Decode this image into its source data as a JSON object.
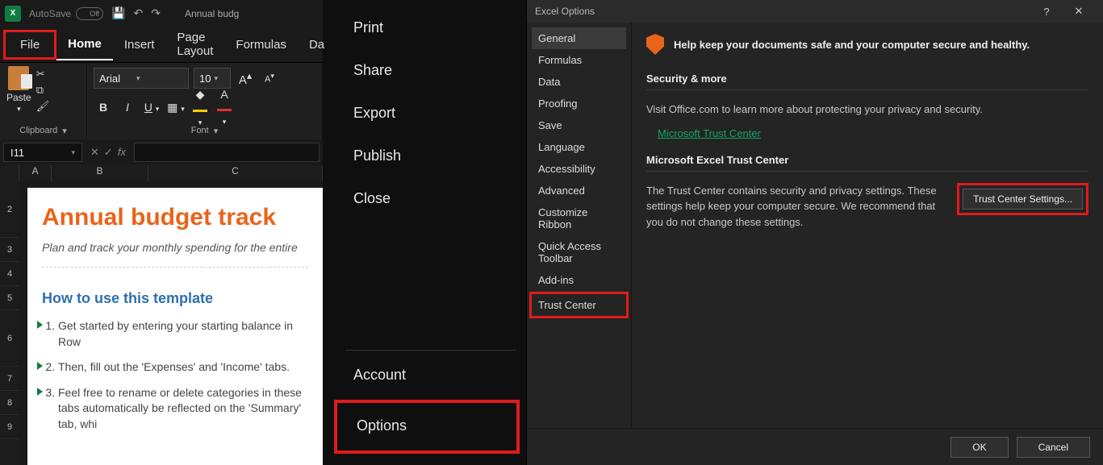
{
  "titlebar": {
    "autosave_label": "AutoSave",
    "autosave_state": "Off",
    "doc_name": "Annual budg"
  },
  "ribbon": {
    "tabs": [
      "File",
      "Home",
      "Insert",
      "Page Layout",
      "Formulas",
      "Da"
    ],
    "clipboard": {
      "paste": "Paste",
      "group": "Clipboard"
    },
    "font": {
      "name": "Arial",
      "size": "10",
      "group": "Font"
    }
  },
  "namebox": "I11",
  "grid": {
    "cols": [
      "A",
      "B",
      "C"
    ],
    "rows": [
      "2",
      "3",
      "4",
      "5",
      "6",
      "7",
      "8",
      "9"
    ]
  },
  "doc": {
    "title": "Annual budget track",
    "sub": "Plan and track your monthly spending for the entire",
    "howto": "How to use this template",
    "steps": [
      "Get started by entering your starting balance in Row",
      "Then, fill out the 'Expenses' and 'Income' tabs.",
      "Feel free to rename or delete categories in these tabs automatically be reflected on the 'Summary' tab, whi"
    ]
  },
  "backstage": {
    "items_top": [
      "Print",
      "Share",
      "Export",
      "Publish",
      "Close"
    ],
    "items_bottom": [
      "Account",
      "Options"
    ]
  },
  "dialog": {
    "title": "Excel Options",
    "nav": [
      "General",
      "Formulas",
      "Data",
      "Proofing",
      "Save",
      "Language",
      "Accessibility",
      "Advanced",
      "Customize Ribbon",
      "Quick Access Toolbar",
      "Add-ins",
      "Trust Center"
    ],
    "banner": "Help keep your documents safe and your computer secure and healthy.",
    "sec1_h": "Security & more",
    "sec1_p": "Visit Office.com to learn more about protecting your privacy and security.",
    "sec1_link": "Microsoft Trust Center",
    "sec2_h": "Microsoft Excel Trust Center",
    "sec2_p": "The Trust Center contains security and privacy settings. These settings help keep your computer secure. We recommend that you do not change these settings.",
    "sec2_btn": "Trust Center Settings...",
    "ok": "OK",
    "cancel": "Cancel"
  }
}
